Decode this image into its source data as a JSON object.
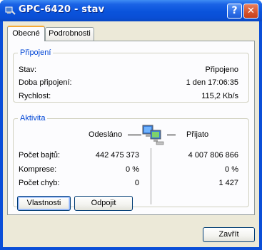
{
  "window": {
    "title": "GPC-6420 - stav",
    "help_label": "?",
    "close_label": "✕"
  },
  "tabs": [
    {
      "label": "Obecné",
      "active": true
    },
    {
      "label": "Podrobnosti",
      "active": false
    }
  ],
  "connection": {
    "legend": "Připojení",
    "status_label": "Stav:",
    "status_value": "Připojeno",
    "duration_label": "Doba připojení:",
    "duration_value": "1 den 17:06:35",
    "speed_label": "Rychlost:",
    "speed_value": "115,2 Kb/s"
  },
  "activity": {
    "legend": "Aktivita",
    "sent_header": "Odesláno",
    "received_header": "Přijato",
    "rows": [
      {
        "label": "Počet bajtů:",
        "sent": "442 475 373",
        "received": "4 007 806 866"
      },
      {
        "label": "Komprese:",
        "sent": "0 %",
        "received": "0 %"
      },
      {
        "label": "Počet chyb:",
        "sent": "0",
        "received": "1 427"
      }
    ]
  },
  "buttons": {
    "properties": "Vlastnosti",
    "disconnect": "Odpojit",
    "close": "Zavřít"
  },
  "icons": {
    "title_icon": "network-connection-icon",
    "activity_icon": "network-computers-icon"
  }
}
